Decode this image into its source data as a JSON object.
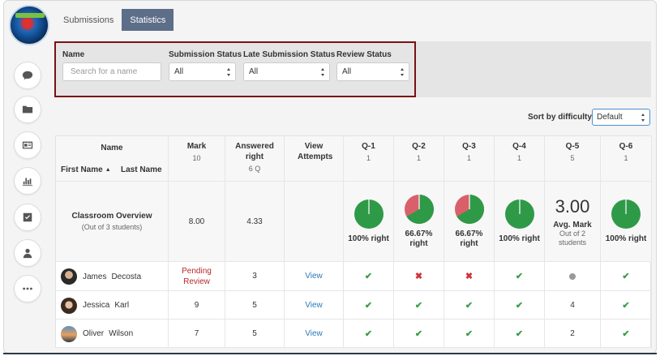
{
  "tabs": [
    {
      "label": "Submissions",
      "active": false
    },
    {
      "label": "Statistics",
      "active": true
    }
  ],
  "rail": [
    "chat-icon",
    "folder-icon",
    "id-card-icon",
    "bar-chart-icon",
    "checkbox-icon",
    "person-icon",
    "more-icon"
  ],
  "filters": {
    "name": {
      "label": "Name",
      "placeholder": "Search for a name"
    },
    "submission_status": {
      "label": "Submission Status",
      "value": "All"
    },
    "late_status": {
      "label": "Late Submission Status",
      "value": "All"
    },
    "review_status": {
      "label": "Review Status",
      "value": "All"
    }
  },
  "sort": {
    "label": "Sort by difficulty",
    "value": "Default"
  },
  "table": {
    "name_header": "Name",
    "first_name_header": "First Name",
    "last_name_header": "Last Name",
    "mark_header": "Mark",
    "mark_sub": "10",
    "answered_header": "Answered right",
    "answered_sub": "6 Q",
    "attempts_header": "View Attempts",
    "questions": [
      {
        "label": "Q-1",
        "points": "1"
      },
      {
        "label": "Q-2",
        "points": "1"
      },
      {
        "label": "Q-3",
        "points": "1"
      },
      {
        "label": "Q-4",
        "points": "1"
      },
      {
        "label": "Q-5",
        "points": "5"
      },
      {
        "label": "Q-6",
        "points": "1"
      }
    ],
    "overview": {
      "title": "Classroom Overview",
      "subtitle": "(Out of 3 students)",
      "mark": "8.00",
      "answered": "4.33",
      "q1": "100% right",
      "q2": "66.67% right",
      "q3": "66.67% right",
      "q4": "100% right",
      "q5_value": "3.00",
      "q5_label": "Avg. Mark",
      "q5_sub": "Out of 2 students",
      "q6": "100% right",
      "pies": [
        1.0,
        0.6667,
        0.6667,
        1.0,
        null,
        1.0
      ]
    },
    "students": [
      {
        "first": "James",
        "last": "Decosta",
        "mark": "Pending Review",
        "answered": "3",
        "view": "View",
        "answers": [
          "check",
          "cross",
          "cross",
          "check",
          "dot",
          "check"
        ]
      },
      {
        "first": "Jessica",
        "last": "Karl",
        "mark": "9",
        "answered": "5",
        "view": "View",
        "answers": [
          "check",
          "check",
          "check",
          "check",
          "4",
          "check"
        ]
      },
      {
        "first": "Oliver",
        "last": "Wilson",
        "mark": "7",
        "answered": "5",
        "view": "View",
        "answers": [
          "check",
          "check",
          "check",
          "check",
          "2",
          "check"
        ]
      }
    ]
  },
  "colors": {
    "pie_right": "#2e9a47",
    "pie_wrong": "#d9606a",
    "tab_active": "#5d6e89",
    "highlight_box": "#7a1015"
  }
}
